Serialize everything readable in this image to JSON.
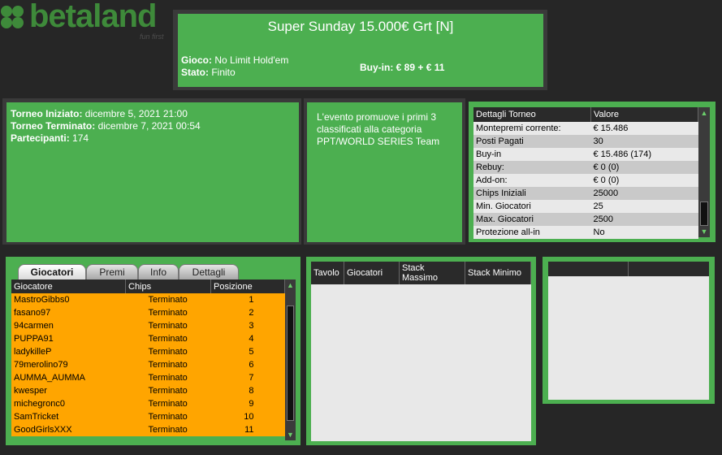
{
  "logo": {
    "name": "betaland",
    "tagline": "fun first"
  },
  "header": {
    "title": "Super Sunday 15.000€ Grt   [N]",
    "gioco_label": "Gioco:",
    "gioco_value": "No Limit Hold'em",
    "stato_label": "Stato:",
    "stato_value": "Finito",
    "buyin": "Buy-in: € 89 + € 11"
  },
  "info": {
    "start_label": "Torneo Iniziato:",
    "start_value": "dicembre 5, 2021 21:00",
    "end_label": "Torneo Terminato:",
    "end_value": "dicembre 7, 2021 00:54",
    "players_label": "Partecipanti:",
    "players_value": "174"
  },
  "description": "L'evento promuove i primi 3 classificati alla categoria PPT/WORLD SERIES Team",
  "details": {
    "headers": [
      "Dettagli Torneo",
      "Valore"
    ],
    "rows": [
      {
        "k": "Montepremi corrente:",
        "v": "€ 15.486"
      },
      {
        "k": "Posti Pagati",
        "v": "30"
      },
      {
        "k": "Buy-in",
        "v": "€ 15.486 (174)"
      },
      {
        "k": "Rebuy:",
        "v": "€ 0 (0)"
      },
      {
        "k": "Add-on:",
        "v": "€ 0 (0)"
      },
      {
        "k": "Chips Iniziali",
        "v": "25000"
      },
      {
        "k": "Min. Giocatori",
        "v": "25"
      },
      {
        "k": "Max. Giocatori",
        "v": "2500"
      },
      {
        "k": "Protezione all-in",
        "v": "No"
      }
    ]
  },
  "tabs": [
    "Giocatori",
    "Premi",
    "Info",
    "Dettagli"
  ],
  "players": {
    "headers": [
      "Giocatore",
      "Chips",
      "Posizione"
    ],
    "rows": [
      {
        "name": "MastroGibbs0",
        "chips": "Terminato",
        "pos": "1"
      },
      {
        "name": "fasano97",
        "chips": "Terminato",
        "pos": "2"
      },
      {
        "name": "94carmen",
        "chips": "Terminato",
        "pos": "3"
      },
      {
        "name": "PUPPA91",
        "chips": "Terminato",
        "pos": "4"
      },
      {
        "name": "ladykilleP",
        "chips": "Terminato",
        "pos": "5"
      },
      {
        "name": "79merolino79",
        "chips": "Terminato",
        "pos": "6"
      },
      {
        "name": "AUMMA_AUMMA",
        "chips": "Terminato",
        "pos": "7"
      },
      {
        "name": "kwesper",
        "chips": "Terminato",
        "pos": "8"
      },
      {
        "name": "michegronc0",
        "chips": "Terminato",
        "pos": "9"
      },
      {
        "name": "SamTricket",
        "chips": "Terminato",
        "pos": "10"
      },
      {
        "name": "GoodGirlsXXX",
        "chips": "Terminato",
        "pos": "11"
      }
    ]
  },
  "tables": {
    "headers": [
      "Tavolo",
      "Giocatori",
      "Stack Massimo",
      "Stack Minimo"
    ]
  },
  "colors": {
    "green": "#4caf50",
    "orange": "#ffa500",
    "background": "#262626"
  }
}
